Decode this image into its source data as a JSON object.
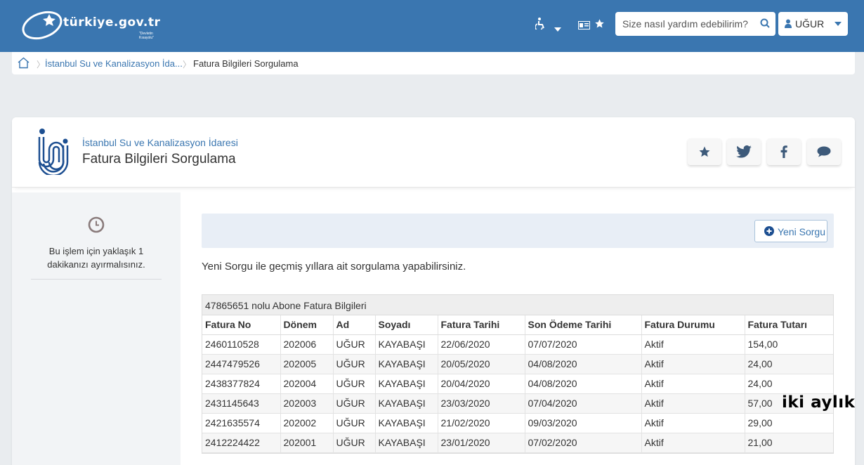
{
  "header": {
    "logo_text": "türkiye.gov.tr",
    "logo_tagline": "\"Devletin Kısayolu\"",
    "search_placeholder": "Size nasıl yardım edebilirim?",
    "user_name": "UĞUR",
    "icons": [
      "accessibility-icon",
      "caret-down-icon",
      "id-card-icon",
      "star-icon",
      "search-icon",
      "user-icon"
    ],
    "brand_color": "#3a76b0"
  },
  "breadcrumb": {
    "items": [
      "İstanbul Su ve Kanalizasyon İda...",
      "Fatura Bilgileri Sorgulama"
    ]
  },
  "page": {
    "institution": "İstanbul Su ve Kanalizasyon İdaresi",
    "title": "Fatura Bilgileri Sorgulama"
  },
  "sidebar": {
    "time_note": "Bu işlem için yaklaşık 1 dakikanızı ayırmalısınız."
  },
  "main": {
    "new_query_label": "Yeni Sorgu",
    "info_text": "Yeni Sorgu ile geçmiş yıllara ait sorgulama yapabilirsiniz.",
    "table": {
      "caption": "47865651 nolu Abone Fatura Bilgileri",
      "columns": [
        "Fatura No",
        "Dönem",
        "Ad",
        "Soyadı",
        "Fatura Tarihi",
        "Son Ödeme Tarihi",
        "Fatura Durumu",
        "Fatura Tutarı"
      ],
      "rows": [
        [
          "2460110528",
          "202006",
          "UĞUR",
          "KAYABAŞI",
          "22/06/2020",
          "07/07/2020",
          "Aktif",
          "154,00"
        ],
        [
          "2447479526",
          "202005",
          "UĞUR",
          "KAYABAŞI",
          "20/05/2020",
          "04/08/2020",
          "Aktif",
          "24,00"
        ],
        [
          "2438377824",
          "202004",
          "UĞUR",
          "KAYABAŞI",
          "20/04/2020",
          "04/08/2020",
          "Aktif",
          "24,00"
        ],
        [
          "2431145643",
          "202003",
          "UĞUR",
          "KAYABAŞI",
          "23/03/2020",
          "07/04/2020",
          "Aktif",
          "57,00"
        ],
        [
          "2421635574",
          "202002",
          "UĞUR",
          "KAYABAŞI",
          "21/02/2020",
          "09/03/2020",
          "Aktif",
          "29,00"
        ],
        [
          "2412224422",
          "202001",
          "UĞUR",
          "KAYABAŞI",
          "23/01/2020",
          "07/02/2020",
          "Aktif",
          "21,00"
        ]
      ]
    }
  },
  "annotation": "iki aylık"
}
